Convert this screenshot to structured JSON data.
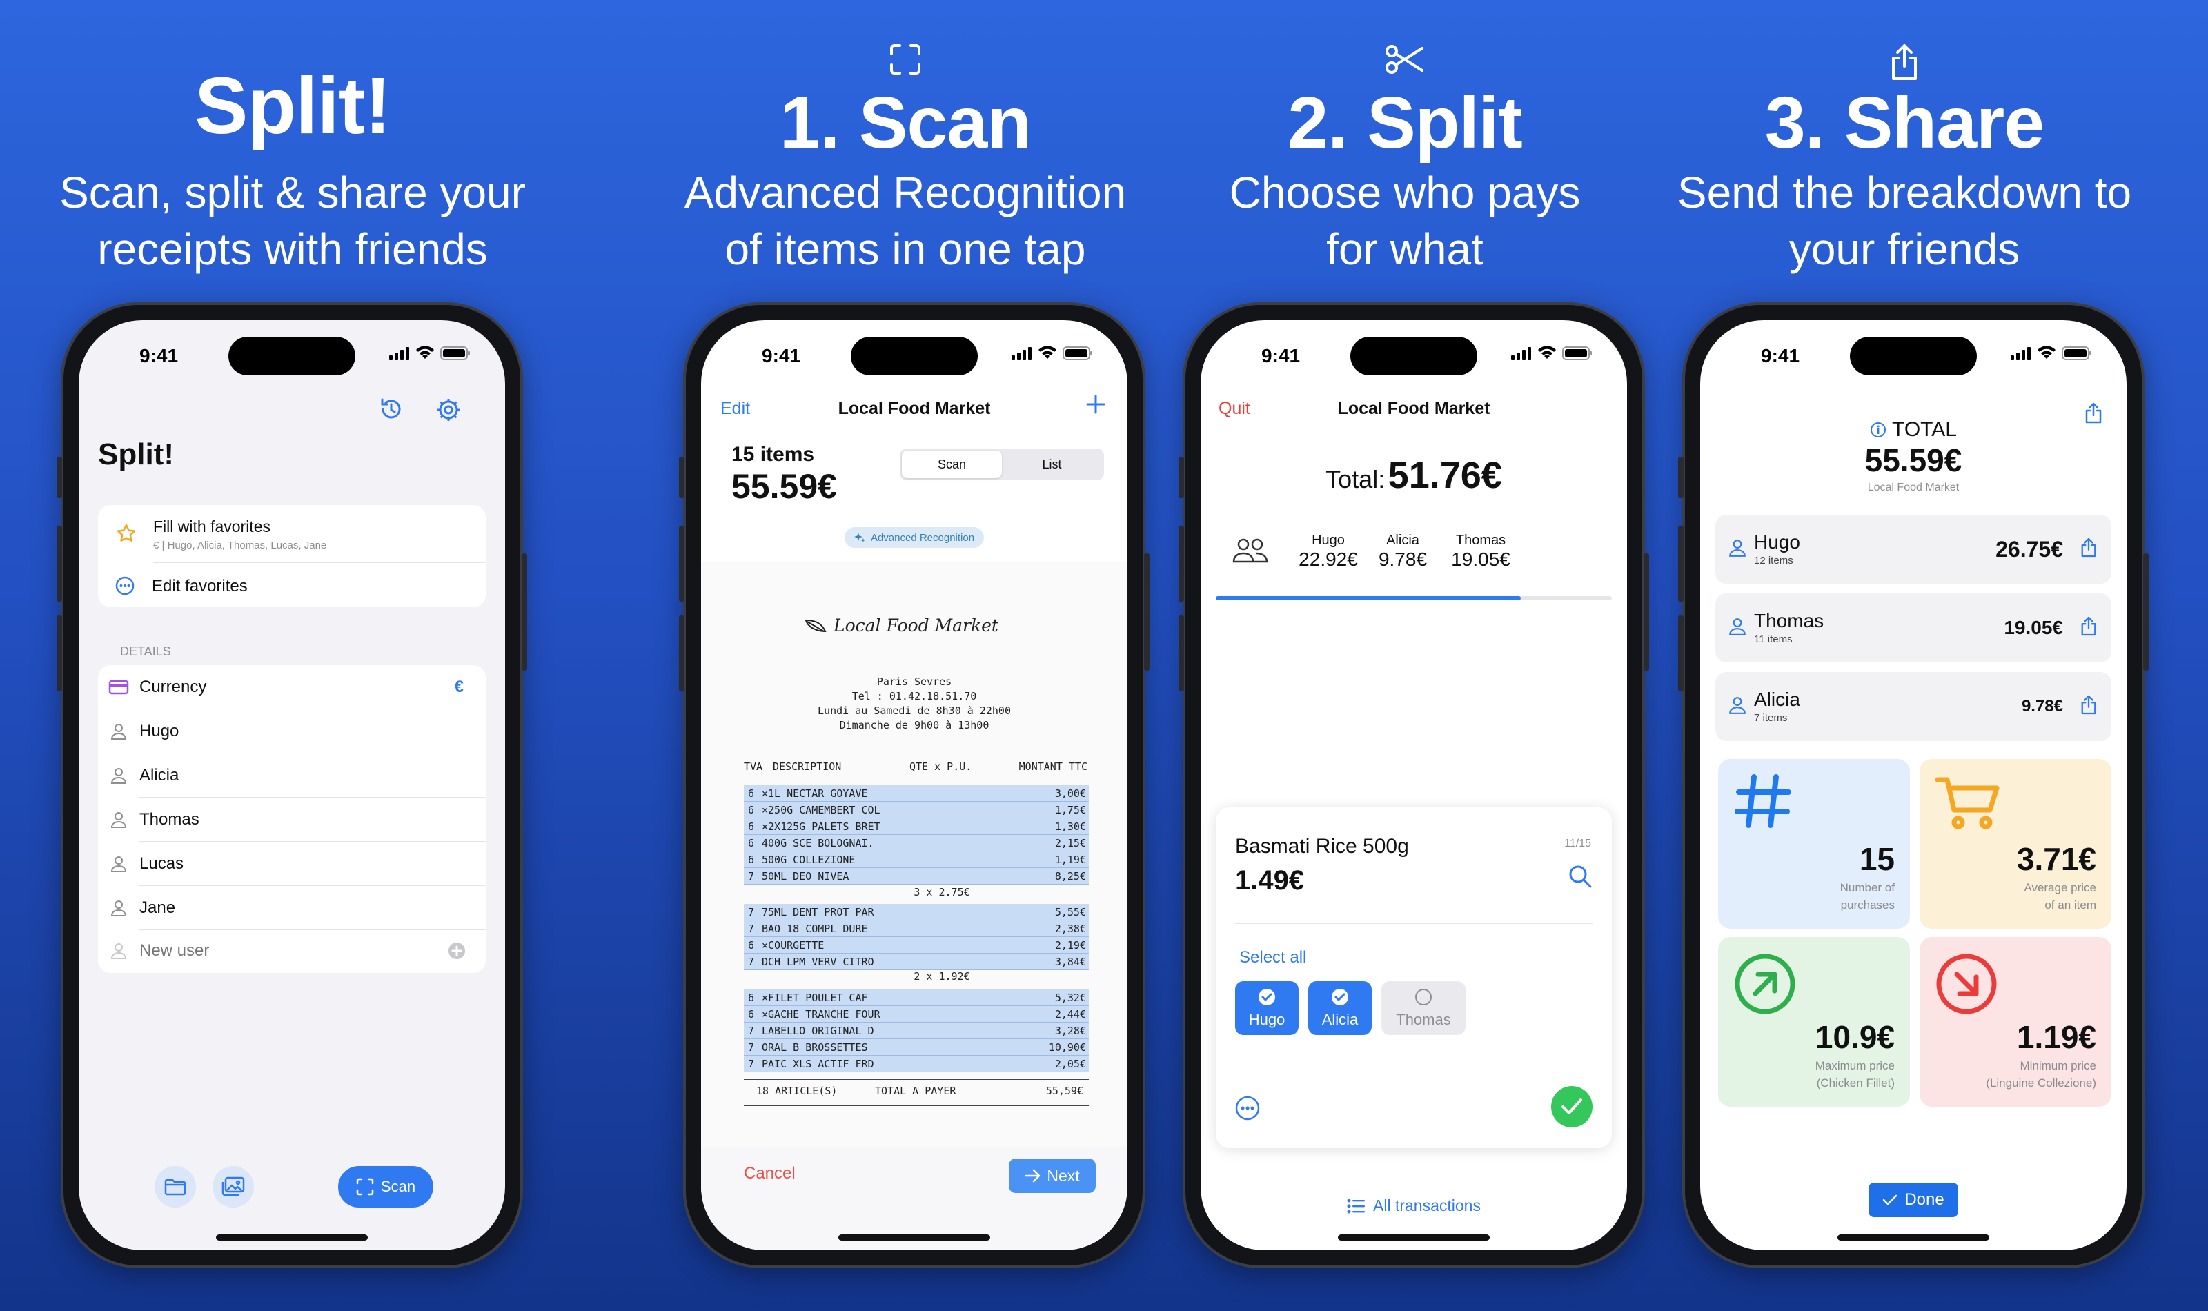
{
  "colors": {
    "accent": "#2f7af1",
    "danger": "#ef3b35",
    "success": "#34c759",
    "warning": "#f5a623"
  },
  "headers": {
    "intro": {
      "title": "Split!",
      "sub1": "Scan, split & share your",
      "sub2": "receipts with friends"
    },
    "scan": {
      "icon": "scan-frame-icon",
      "title": "1. Scan",
      "sub1": "Advanced Recognition",
      "sub2": "of items in one tap"
    },
    "split": {
      "icon": "scissors-icon",
      "title": "2. Split",
      "sub1": "Choose who pays",
      "sub2": "for what"
    },
    "share": {
      "icon": "share-icon",
      "title": "3. Share",
      "sub1": "Send the breakdown to",
      "sub2": "your friends"
    }
  },
  "status_time": "9:41",
  "home": {
    "title": "Split!",
    "fill_title": "Fill with favorites",
    "fill_sub": "€ | Hugo, Alicia, Thomas, Lucas, Jane",
    "edit_fav": "Edit favorites",
    "details_label": "DETAILS",
    "currency_label": "Currency",
    "currency_value": "€",
    "users": [
      "Hugo",
      "Alicia",
      "Thomas",
      "Lucas",
      "Jane"
    ],
    "new_user_placeholder": "New user",
    "scan_button": "Scan"
  },
  "scan": {
    "edit": "Edit",
    "title": "Local Food Market",
    "items_count": "15 items",
    "total": "55.59€",
    "seg_scan": "Scan",
    "seg_list": "List",
    "badge": "Advanced Recognition",
    "receipt": {
      "store": "Local Food Market",
      "addr": "Paris Sevres",
      "tel": "Tel : 01.42.18.51.70",
      "hours1": "Lundi au Samedi de 8h30 à 22h00",
      "hours2": "Dimanche       de 9h00 à 13h00",
      "head_tva": "TVA",
      "head_desc": "DESCRIPTION",
      "head_qte": "QTE x P.U.",
      "head_amt": "MONTANT TTC",
      "group1": [
        {
          "t": "6",
          "d": "×1L NECTAR GOYAVE",
          "a": "3,00€"
        },
        {
          "t": "6",
          "d": "×250G CAMEMBERT COL",
          "a": "1,75€"
        },
        {
          "t": "6",
          "d": "×2X125G PALETS BRET",
          "a": "1,30€"
        },
        {
          "t": "6",
          "d": "400G SCE BOLOGNAI.",
          "a": "2,15€"
        },
        {
          "t": "6",
          "d": "500G COLLEZIONE",
          "a": "1,19€"
        },
        {
          "t": "7",
          "d": "50ML DEO NIVEA",
          "a": "8,25€"
        }
      ],
      "mult1": "3 x 2.75€",
      "group2": [
        {
          "t": "7",
          "d": "75ML DENT PROT PAR",
          "a": "5,55€"
        },
        {
          "t": "7",
          "d": "BAO 18 COMPL DURE",
          "a": "2,38€"
        },
        {
          "t": "6",
          "d": "×COURGETTE",
          "a": "2,19€"
        },
        {
          "t": "7",
          "d": "DCH LPM VERV CITRO",
          "a": "3,84€"
        }
      ],
      "mult2": "2 x 1.92€",
      "group3": [
        {
          "t": "6",
          "d": "×FILET POULET CAF",
          "a": "5,32€"
        },
        {
          "t": "6",
          "d": "×GACHE TRANCHE FOUR",
          "a": "2,44€"
        },
        {
          "t": "7",
          "d": "LABELLO ORIGINAL D",
          "a": "3,28€"
        },
        {
          "t": "7",
          "d": "ORAL B BROSSETTES",
          "a": "10,90€"
        },
        {
          "t": "7",
          "d": "PAIC XLS ACTIF FRD",
          "a": "2,05€"
        }
      ],
      "total_articles": "18 ARTICLE(S)",
      "total_label": "TOTAL A PAYER",
      "total_amount": "55,59€"
    },
    "cancel": "Cancel",
    "next": "Next"
  },
  "split": {
    "quit": "Quit",
    "title": "Local Food Market",
    "total_label": "Total:",
    "total_value": "51.76€",
    "people": [
      {
        "name": "Hugo",
        "amount": "22.92€"
      },
      {
        "name": "Alicia",
        "amount": "9.78€"
      },
      {
        "name": "Thomas",
        "amount": "19.05€"
      }
    ],
    "progress": 0.77,
    "item_name": "Basmati Rice 500g",
    "item_price": "1.49€",
    "item_counter": "11/15",
    "select_all": "Select all",
    "chips": [
      {
        "name": "Hugo",
        "selected": true
      },
      {
        "name": "Alicia",
        "selected": true
      },
      {
        "name": "Thomas",
        "selected": false
      }
    ],
    "all_transactions": "All transactions"
  },
  "share": {
    "total_label": "TOTAL",
    "total_value": "55.59€",
    "store": "Local Food Market",
    "people": [
      {
        "name": "Hugo",
        "items": "12 items",
        "amount": "26.75€"
      },
      {
        "name": "Thomas",
        "items": "11 items",
        "amount": "19.05€"
      },
      {
        "name": "Alicia",
        "items": "7 items",
        "amount": "9.78€"
      }
    ],
    "stats": [
      {
        "value": "15",
        "label1": "Number of",
        "label2": "purchases"
      },
      {
        "value": "3.71€",
        "label1": "Average price",
        "label2": "of an item"
      },
      {
        "value": "10.9€",
        "label1": "Maximum price",
        "label2": "(Chicken Fillet)"
      },
      {
        "value": "1.19€",
        "label1": "Minimum price",
        "label2": "(Linguine Collezione)"
      }
    ],
    "done": "Done"
  }
}
